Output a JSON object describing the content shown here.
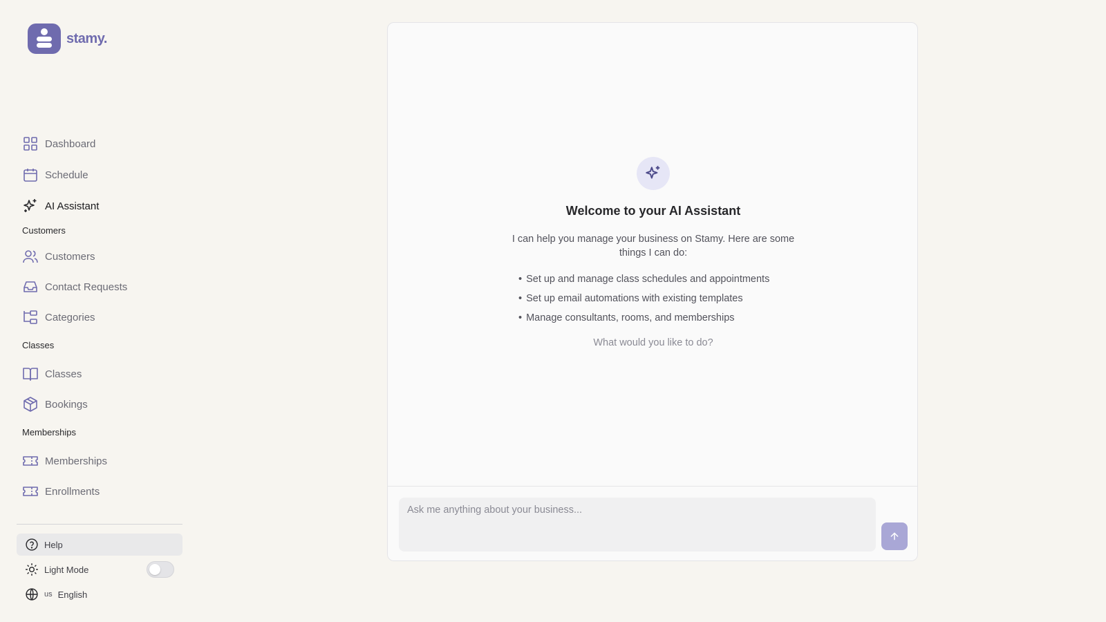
{
  "brand": {
    "name": "stamy.",
    "accent": "#6f6bae"
  },
  "sidebar": {
    "top_items": [
      {
        "label": "Dashboard",
        "icon": "dashboard-grid-icon"
      },
      {
        "label": "Schedule",
        "icon": "calendar-icon"
      },
      {
        "label": "AI Assistant",
        "icon": "sparkles-icon",
        "active": true
      }
    ],
    "sections": [
      {
        "title": "Customers",
        "items": [
          {
            "label": "Customers",
            "icon": "users-icon"
          },
          {
            "label": "Contact Requests",
            "icon": "inbox-icon"
          },
          {
            "label": "Categories",
            "icon": "categories-tree-icon"
          }
        ]
      },
      {
        "title": "Classes",
        "items": [
          {
            "label": "Classes",
            "icon": "book-open-icon"
          },
          {
            "label": "Bookings",
            "icon": "package-icon"
          }
        ]
      },
      {
        "title": "Memberships",
        "items": [
          {
            "label": "Memberships",
            "icon": "ticket-icon"
          },
          {
            "label": "Enrollments",
            "icon": "ticket-icon"
          }
        ]
      }
    ],
    "bottom": {
      "help": "Help",
      "theme": "Light Mode",
      "language_flag": "us",
      "language": "English"
    }
  },
  "assistant": {
    "title": "Welcome to your AI Assistant",
    "description": "I can help you manage your business on Stamy. Here are some things I can do:",
    "capabilities": [
      "Set up and manage class schedules and appointments",
      "Set up email automations with existing templates",
      "Manage consultants, rooms, and memberships"
    ],
    "prompt": "What would you like to do?",
    "input_placeholder": "Ask me anything about your business..."
  }
}
